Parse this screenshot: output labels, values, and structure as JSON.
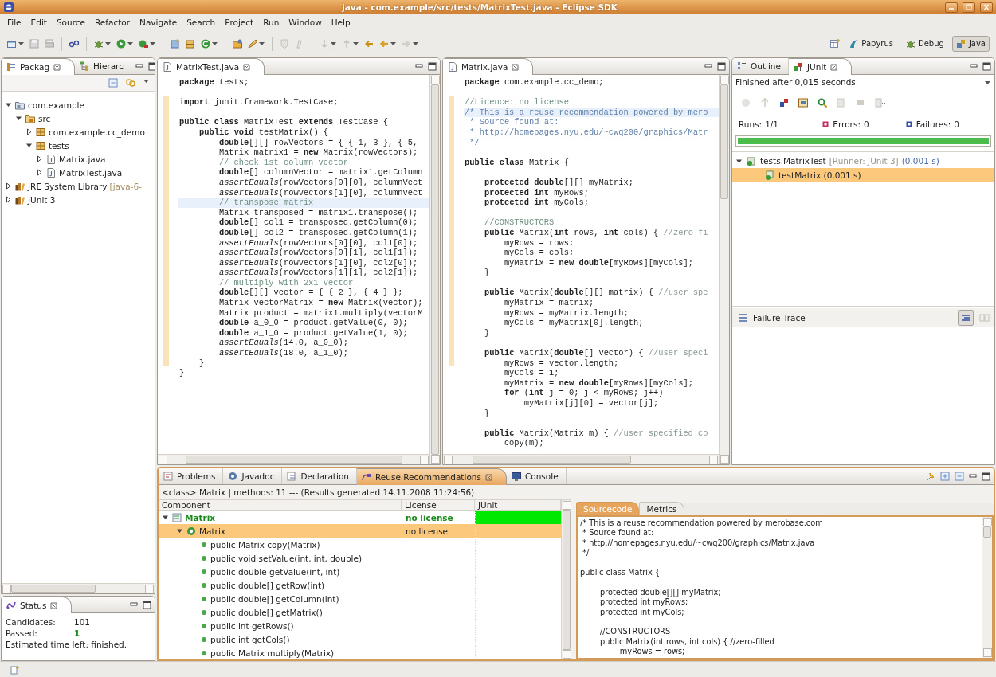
{
  "window": {
    "title": "java - com.example/src/tests/MatrixTest.java - Eclipse SDK"
  },
  "menu": [
    "File",
    "Edit",
    "Source",
    "Refactor",
    "Navigate",
    "Search",
    "Project",
    "Run",
    "Window",
    "Help"
  ],
  "perspectives": [
    {
      "label": "Papyrus",
      "selected": false
    },
    {
      "label": "Debug",
      "selected": false
    },
    {
      "label": "Java",
      "selected": true
    }
  ],
  "package_explorer": {
    "tabs": [
      {
        "label": "Packag",
        "selected": true
      },
      {
        "label": "Hierarc",
        "selected": false
      }
    ],
    "tree": [
      {
        "label": "com.example",
        "kind": "project",
        "expanded": true,
        "children": [
          {
            "label": "src",
            "kind": "source-folder",
            "expanded": true,
            "children": [
              {
                "label": "com.example.cc_demo",
                "kind": "package",
                "expanded": false
              },
              {
                "label": "tests",
                "kind": "package",
                "expanded": true,
                "children": [
                  {
                    "label": "Matrix.java",
                    "kind": "file",
                    "expanded": false
                  },
                  {
                    "label": "MatrixTest.java",
                    "kind": "file",
                    "expanded": false
                  }
                ]
              }
            ]
          }
        ]
      },
      {
        "label": "JRE System Library",
        "suffix": "[java-6-",
        "kind": "library",
        "expanded": false
      },
      {
        "label": "JUnit 3",
        "kind": "library",
        "expanded": false
      }
    ]
  },
  "status_view": {
    "tab": "Status",
    "rows": [
      {
        "label": "Candidates:",
        "value": "101",
        "kind": "count"
      },
      {
        "label": "Passed:",
        "value": "1",
        "kind": "passed"
      }
    ],
    "note": "Estimated time left: finished."
  },
  "editors": [
    {
      "tab": "MatrixTest.java",
      "blocks": [
        [
          {
            "kind": "code",
            "text": "**package** tests;",
            "current": false
          }
        ],
        [
          {
            "kind": "code",
            "text": "**import** junit.framework.TestCase;",
            "current": false
          }
        ],
        [
          {
            "kind": "code",
            "text": "**public** **class** MatrixTest **extends** TestCase {",
            "current": false
          },
          {
            "kind": "code",
            "text": "    **public** **void** testMatrix() {",
            "current": false
          },
          {
            "kind": "code",
            "text": "        **double**[][] rowVectors = { { 1, 3 }, { 5,",
            "current": false
          },
          {
            "kind": "code",
            "text": "        Matrix matrix1 = **new** Matrix(rowVectors);",
            "current": false
          },
          {
            "kind": "comment",
            "text": "        // check 1st column vector",
            "current": false
          },
          {
            "kind": "code",
            "text": "        **double**[] columnVector = matrix1.getColumn",
            "current": false
          },
          {
            "kind": "code",
            "text": "        *assertEquals*(rowVectors[0][0], columnVect",
            "current": false
          },
          {
            "kind": "code",
            "text": "        *assertEquals*(rowVectors[1][0], columnVect",
            "current": false
          },
          {
            "kind": "comment",
            "text": "        // transpose matrix",
            "current": true
          },
          {
            "kind": "code",
            "text": "        Matrix transposed = matrix1.transpose();",
            "current": false
          },
          {
            "kind": "code",
            "text": "        **double**[] col1 = transposed.getColumn(0);",
            "current": false
          },
          {
            "kind": "code",
            "text": "        **double**[] col2 = transposed.getColumn(1);",
            "current": false
          },
          {
            "kind": "code",
            "text": "        *assertEquals*(rowVectors[0][0], col1[0]);",
            "current": false
          },
          {
            "kind": "code",
            "text": "        *assertEquals*(rowVectors[0][1], col1[1]);",
            "current": false
          },
          {
            "kind": "code",
            "text": "        *assertEquals*(rowVectors[1][0], col2[0]);",
            "current": false
          },
          {
            "kind": "code",
            "text": "        *assertEquals*(rowVectors[1][1], col2[1]);",
            "current": false
          },
          {
            "kind": "comment",
            "text": "        // multiply with 2x1 vector",
            "current": false
          },
          {
            "kind": "code",
            "text": "        **double**[][] vector = { { 2 }, { 4 } };",
            "current": false
          },
          {
            "kind": "code",
            "text": "        Matrix vectorMatrix = **new** Matrix(vector);",
            "current": false
          },
          {
            "kind": "code",
            "text": "        Matrix product = matrix1.multiply(vectorM",
            "current": false
          },
          {
            "kind": "code",
            "text": "        **double** a_0_0 = product.getValue(0, 0);",
            "current": false
          },
          {
            "kind": "code",
            "text": "        **double** a_1_0 = product.getValue(1, 0);",
            "current": false
          },
          {
            "kind": "code",
            "text": "        *assertEquals*(14.0, a_0_0);",
            "current": false
          },
          {
            "kind": "code",
            "text": "        *assertEquals*(18.0, a_1_0);",
            "current": false
          },
          {
            "kind": "code",
            "text": "    }",
            "current": false
          },
          {
            "kind": "code",
            "text": "}",
            "current": false
          }
        ]
      ]
    },
    {
      "tab": "Matrix.java",
      "blocks": [
        [
          {
            "kind": "code",
            "text": "**package** com.example.cc_demo;",
            "current": false
          }
        ],
        [
          {
            "kind": "comment",
            "text": "//Licence: no license",
            "current": false
          },
          {
            "kind": "doc",
            "text": "/* This is a reuse recommendation powered by mero",
            "current": true
          },
          {
            "kind": "doc",
            "text": " * Source found at:",
            "current": false
          },
          {
            "kind": "doc",
            "text": " * http://homepages.nyu.edu/~cwq200/graphics/Matr",
            "current": false
          },
          {
            "kind": "doc",
            "text": " */",
            "current": false
          }
        ],
        [
          {
            "kind": "code",
            "text": "**public** **class** Matrix {",
            "current": false
          }
        ],
        [
          {
            "kind": "code",
            "text": "    **protected** **double**[][] myMatrix;",
            "current": false
          },
          {
            "kind": "code",
            "text": "    **protected** **int** myRows;",
            "current": false
          },
          {
            "kind": "code",
            "text": "    **protected** **int** myCols;",
            "current": false
          }
        ],
        [
          {
            "kind": "comment",
            "text": "    //CONSTRUCTORS",
            "current": false
          },
          {
            "kind": "code",
            "text": "    **public** Matrix(**int** rows, **int** cols) { ",
            "comment": "//zero-fi",
            "current": false
          },
          {
            "kind": "code",
            "text": "        myRows = rows;",
            "current": false
          },
          {
            "kind": "code",
            "text": "        myCols = cols;",
            "current": false
          },
          {
            "kind": "code",
            "text": "        myMatrix = **new** **double**[myRows][myCols];",
            "current": false
          },
          {
            "kind": "code",
            "text": "    }",
            "current": false
          }
        ],
        [
          {
            "kind": "code",
            "text": "    **public** Matrix(**double**[][] matrix) { ",
            "comment": "//user spe",
            "current": false
          },
          {
            "kind": "code",
            "text": "        myMatrix = matrix;",
            "current": false
          },
          {
            "kind": "code",
            "text": "        myRows = myMatrix.length;",
            "current": false
          },
          {
            "kind": "code",
            "text": "        myCols = myMatrix[0].length;",
            "current": false
          },
          {
            "kind": "code",
            "text": "    }",
            "current": false
          }
        ],
        [
          {
            "kind": "code",
            "text": "    **public** Matrix(**double**[] vector) { ",
            "comment": "//user speci",
            "current": false
          },
          {
            "kind": "code",
            "text": "        myRows = vector.length;",
            "current": false
          },
          {
            "kind": "code",
            "text": "        myCols = 1;",
            "current": false
          },
          {
            "kind": "code",
            "text": "        myMatrix = **new** **double**[myRows][myCols];",
            "current": false
          },
          {
            "kind": "code",
            "text": "        **for** (**int** j = 0; j < myRows; j++)",
            "current": false
          },
          {
            "kind": "code",
            "text": "            myMatrix[j][0] = vector[j];",
            "current": false
          },
          {
            "kind": "code",
            "text": "    }",
            "current": false
          }
        ],
        [
          {
            "kind": "code",
            "text": "    **public** Matrix(Matrix m) { ",
            "comment": "//user specified co",
            "current": false
          },
          {
            "kind": "code",
            "text": "        copy(m);",
            "current": false
          }
        ]
      ]
    }
  ],
  "junit": {
    "tabs": [
      {
        "label": "Outline",
        "selected": false
      },
      {
        "label": "JUnit",
        "selected": true
      }
    ],
    "message": "Finished after 0,015 seconds",
    "counters": [
      {
        "label": "Runs:",
        "value": "1/1",
        "kind": "runs"
      },
      {
        "label": "Errors:",
        "value": "0",
        "kind": "errors"
      },
      {
        "label": "Failures:",
        "value": "0",
        "kind": "failures"
      }
    ],
    "progress": {
      "level": 1,
      "kind": "success"
    },
    "tree": [
      {
        "label": "tests.MatrixTest",
        "runner": "[Runner: JUnit 3]",
        "time": "(0.001 s)",
        "expanded": true,
        "selected": false,
        "children": [
          {
            "label": "testMatrix (0,001 s)",
            "selected": true
          }
        ]
      }
    ],
    "failure_trace": "Failure Trace"
  },
  "bottom": {
    "tabs": [
      {
        "label": "Problems",
        "selected": false
      },
      {
        "label": "Javadoc",
        "selected": false
      },
      {
        "label": "Declaration",
        "selected": false
      },
      {
        "label": "Reuse Recommendations",
        "selected": true
      },
      {
        "label": "Console",
        "selected": false
      }
    ],
    "info": "<class> Matrix | methods: 11 --- (Results generated 14.11.2008 11:24:56)",
    "columns": [
      "Component",
      "License",
      "JUnit"
    ],
    "rows": [
      {
        "label": "Matrix",
        "kind": "class",
        "license": "no license",
        "color": "#00e800",
        "expanded": true,
        "selected": false,
        "children": [
          {
            "label": "Matrix",
            "kind": "constructor",
            "license": "no license",
            "expanded": true,
            "selected": true,
            "children": [
              {
                "label": "public Matrix copy(Matrix)",
                "kind": "method",
                "selected": false
              },
              {
                "label": "public void setValue(int, int, double)",
                "kind": "method",
                "selected": false
              },
              {
                "label": "public double getValue(int, int)",
                "kind": "method",
                "selected": false
              },
              {
                "label": "public double[] getRow(int)",
                "kind": "method",
                "selected": false
              },
              {
                "label": "public double[] getColumn(int)",
                "kind": "method",
                "selected": false
              },
              {
                "label": "public double[] getMatrix()",
                "kind": "method",
                "selected": false
              },
              {
                "label": "public int getRows()",
                "kind": "method",
                "selected": false
              },
              {
                "label": "public int getCols()",
                "kind": "method",
                "selected": false
              },
              {
                "label": "public Matrix multiply(Matrix)",
                "kind": "method",
                "selected": false
              }
            ]
          }
        ]
      }
    ],
    "source_tabs": [
      {
        "label": "Sourcecode",
        "selected": true
      },
      {
        "label": "Metrics",
        "selected": false
      }
    ],
    "source": [
      [
        "/* This is a reuse recommendation powered by merobase.com",
        " * Source found at:",
        " * http://homepages.nyu.edu/~cwq200/graphics/Matrix.java",
        " */"
      ],
      [
        "public class Matrix {"
      ],
      [
        "        protected double[][] myMatrix;",
        "        protected int myRows;",
        "        protected int myCols;"
      ],
      [
        "        //CONSTRUCTORS",
        "        public Matrix(int rows, int cols) { //zero-filled",
        "                myRows = rows;"
      ]
    ]
  }
}
